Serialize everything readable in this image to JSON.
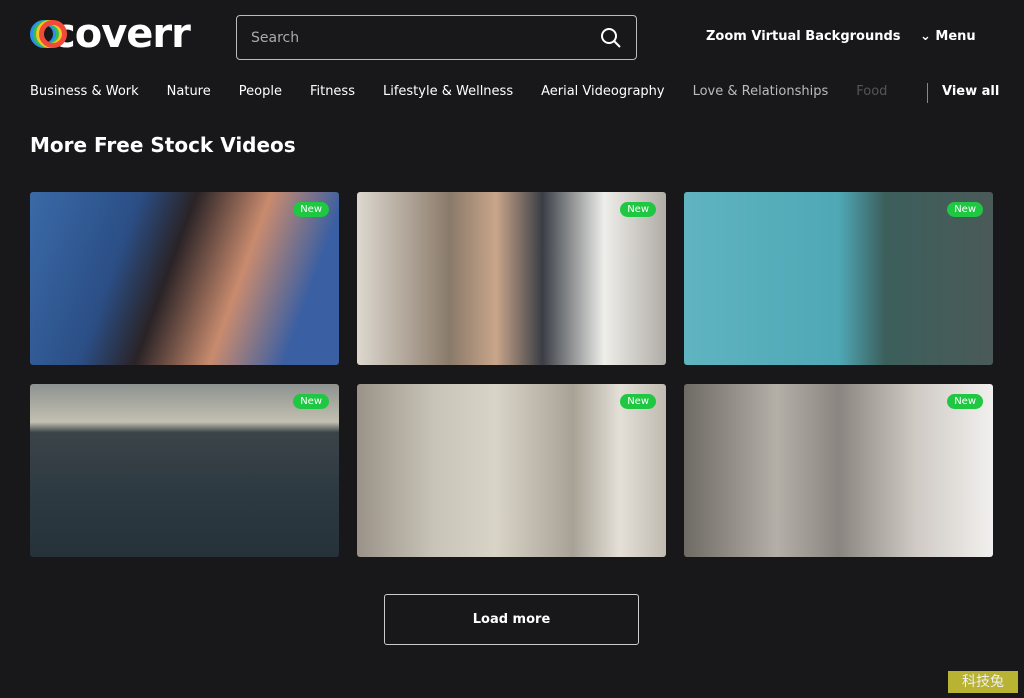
{
  "header": {
    "logo": "coverr",
    "search_placeholder": "Search",
    "zoom_link": "Zoom Virtual Backgrounds",
    "menu": "Menu"
  },
  "nav": [
    "Business & Work",
    "Nature",
    "People",
    "Fitness",
    "Lifestyle & Wellness",
    "Aerial Videography",
    "Love & Relationships",
    "Food"
  ],
  "view_all": "View all",
  "section_title": "More Free Stock Videos",
  "videos": [
    {
      "badge": "New"
    },
    {
      "badge": "New"
    },
    {
      "badge": "New"
    },
    {
      "badge": "New"
    },
    {
      "badge": "New"
    },
    {
      "badge": "New"
    }
  ],
  "load_more": "Load more",
  "watermark": "科技兔"
}
